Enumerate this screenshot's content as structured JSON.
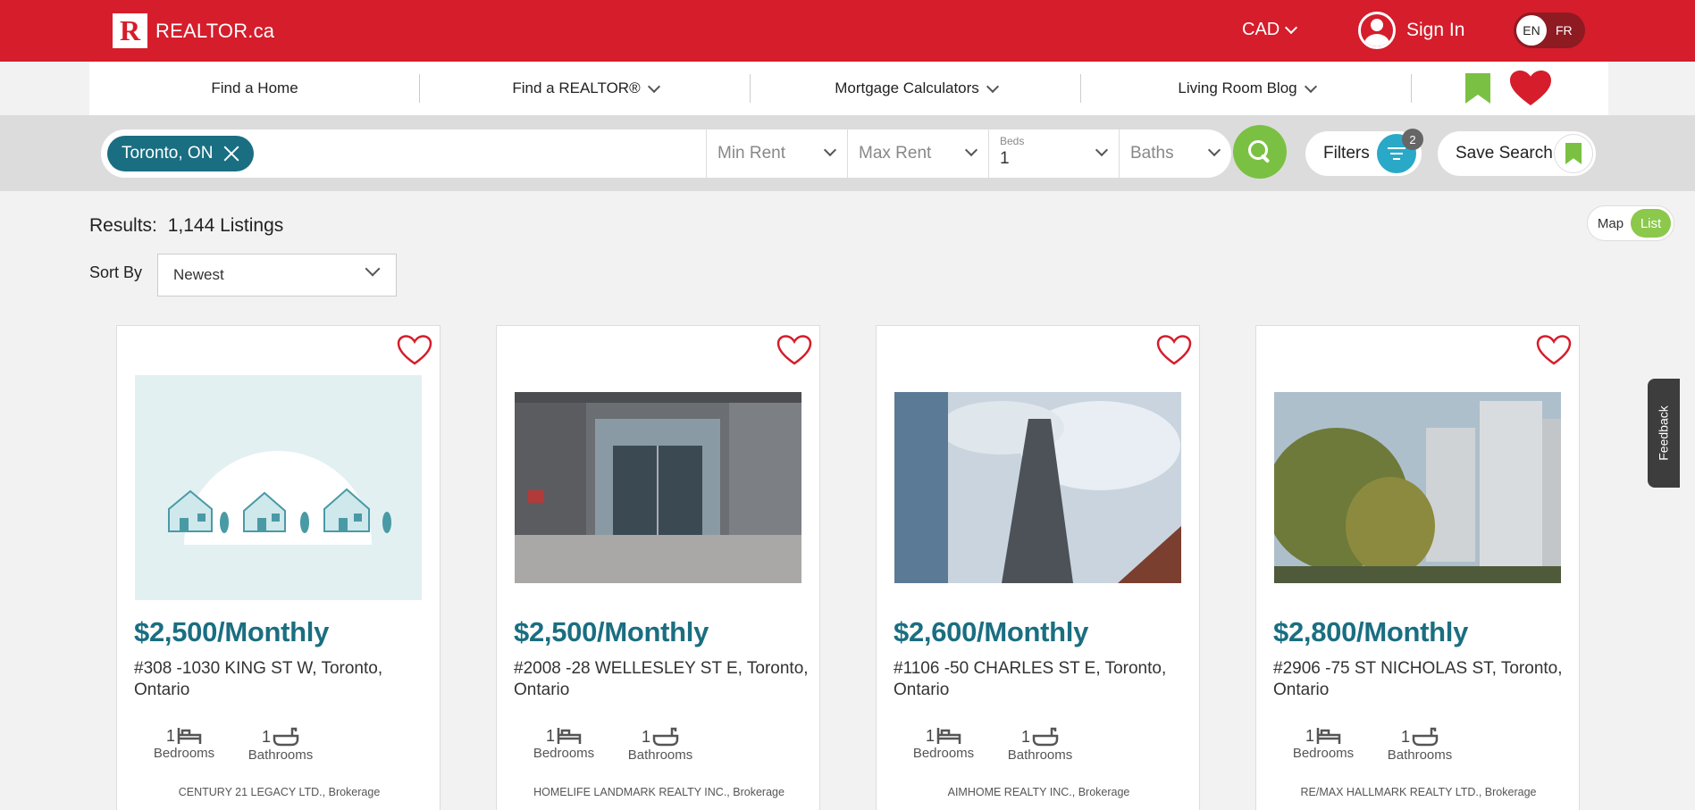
{
  "header": {
    "logo_mark": "R",
    "logo_text": "REALTOR.ca",
    "currency": "CAD",
    "sign_in": "Sign In",
    "lang_en": "EN",
    "lang_fr": "FR",
    "brand_red": "#d51d2b"
  },
  "nav": {
    "items": [
      {
        "label": "Find a Home",
        "dropdown": false
      },
      {
        "label": "Find a REALTOR®",
        "dropdown": true
      },
      {
        "label": "Mortgage Calculators",
        "dropdown": true
      },
      {
        "label": "Living Room Blog",
        "dropdown": true
      }
    ],
    "icons": [
      "bookmark-icon",
      "heart-icon"
    ]
  },
  "search": {
    "location_chip": "Toronto, ON",
    "min_rent": "Min Rent",
    "max_rent": "Max Rent",
    "beds_label": "Beds",
    "beds_value": "1",
    "baths": "Baths",
    "filters_label": "Filters",
    "filters_count": "2",
    "save_search_label": "Save Search",
    "accent_green": "#7ac143",
    "accent_teal": "#1a6e81"
  },
  "results": {
    "label": "Results:",
    "count": "1,144 Listings",
    "sort_label": "Sort By",
    "sort_value": "Newest",
    "view_map": "Map",
    "view_list": "List"
  },
  "listings": [
    {
      "price": "$2,500/Monthly",
      "address": "#308 -1030 KING ST W, Toronto, Ontario",
      "beds": "1",
      "beds_label": "Bedrooms",
      "baths": "1",
      "baths_label": "Bathrooms",
      "brokerage": "CENTURY 21 LEGACY LTD., Brokerage",
      "photo": "placeholder-houses"
    },
    {
      "price": "$2,500/Monthly",
      "address": "#2008 -28 WELLESLEY ST E, Toronto, Ontario",
      "beds": "1",
      "beds_label": "Bedrooms",
      "baths": "1",
      "baths_label": "Bathrooms",
      "brokerage": "HOMELIFE LANDMARK REALTY INC., Brokerage",
      "photo": "building-entrance"
    },
    {
      "price": "$2,600/Monthly",
      "address": "#1106 -50 CHARLES ST E, Toronto, Ontario",
      "beds": "1",
      "beds_label": "Bedrooms",
      "baths": "1",
      "baths_label": "Bathrooms",
      "brokerage": "AIMHOME REALTY INC., Brokerage",
      "photo": "tower-sky"
    },
    {
      "price": "$2,800/Monthly",
      "address": "#2906 -75 ST NICHOLAS ST, Toronto, Ontario",
      "beds": "1",
      "beds_label": "Bedrooms",
      "baths": "1",
      "baths_label": "Bathrooms",
      "brokerage": "RE/MAX HALLMARK REALTY LTD., Brokerage",
      "photo": "trees-towers"
    }
  ],
  "feedback": "Feedback"
}
